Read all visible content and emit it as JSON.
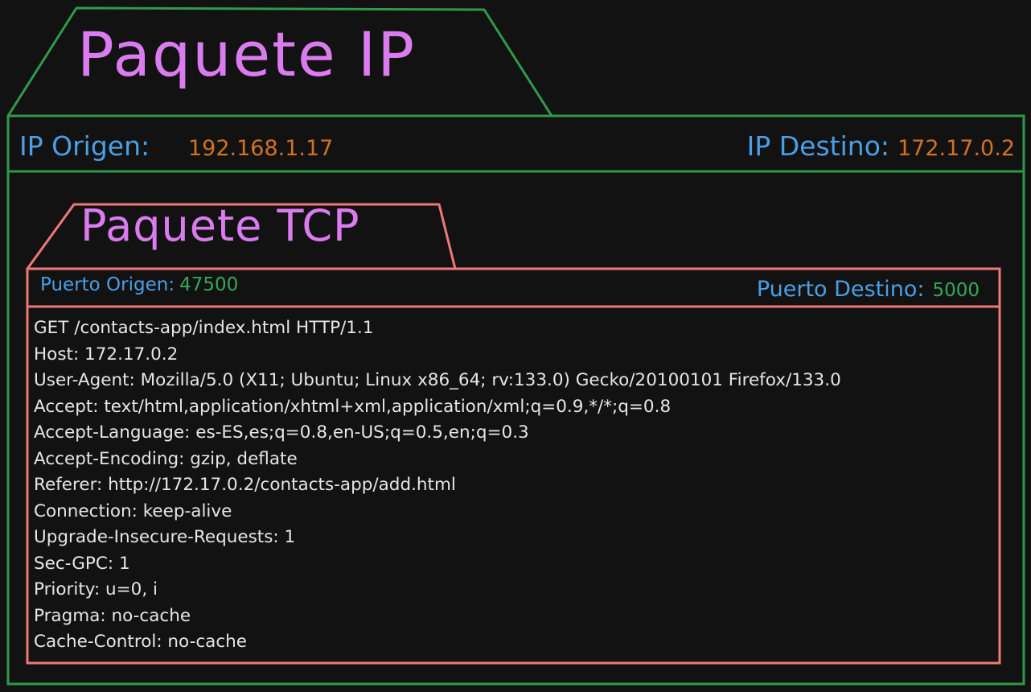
{
  "ip_packet": {
    "title": "Paquete IP",
    "source_label": "IP Origen:",
    "source_value": "192.168.1.17",
    "dest_label": "IP Destino:",
    "dest_value": "172.17.0.2"
  },
  "tcp_packet": {
    "title": "Paquete TCP",
    "source_port_label": "Puerto Origen:",
    "source_port_value": "47500",
    "dest_port_label": "Puerto Destino:",
    "dest_port_value": "5000"
  },
  "http_request_lines": [
    "GET /contacts-app/index.html HTTP/1.1",
    "Host: 172.17.0.2",
    "User-Agent: Mozilla/5.0 (X11; Ubuntu; Linux x86_64; rv:133.0) Gecko/20100101 Firefox/133.0",
    "Accept: text/html,application/xhtml+xml,application/xml;q=0.9,*/*;q=0.8",
    "Accept-Language: es-ES,es;q=0.8,en-US;q=0.5,en;q=0.3",
    "Accept-Encoding: gzip, deflate",
    "Referer: http://172.17.0.2/contacts-app/add.html",
    "Connection: keep-alive",
    "Upgrade-Insecure-Requests: 1",
    "Sec-GPC: 1",
    "Priority: u=0, i",
    "Pragma: no-cache",
    "Cache-Control: no-cache"
  ],
  "colors": {
    "background": "#121212",
    "ip_border": "#2f9a4a",
    "tcp_border": "#f07878",
    "title": "#da7cf0",
    "label": "#4a9fe6",
    "ip_value": "#d2721f",
    "port_value": "#34a85a",
    "body_text": "#e6e6e6"
  }
}
